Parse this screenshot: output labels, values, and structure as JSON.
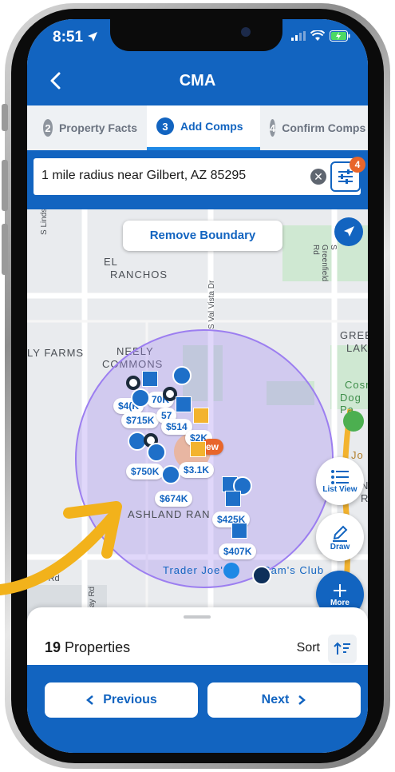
{
  "status": {
    "time": "8:51"
  },
  "header": {
    "title": "CMA"
  },
  "steps": [
    {
      "num": "2",
      "label": "Property Facts"
    },
    {
      "num": "3",
      "label": "Add Comps"
    },
    {
      "num": "4",
      "label": "Confirm Comps"
    }
  ],
  "search": {
    "query": "1 mile radius near Gilbert, AZ 85295",
    "filter_count": "4"
  },
  "map": {
    "remove_boundary_label": "Remove Boundary",
    "labels": {
      "el_ranchos_1": "EL",
      "el_ranchos_2": "RANCHOS",
      "neely_commons_1": "NEELY",
      "neely_commons_2": "COMMONS",
      "ly_farms": "LY FARMS",
      "greenfield_lakes_1": "GREENF",
      "greenfield_lakes_2": "LAKE",
      "ashland_ranch": "ASHLAND RAN",
      "trader_joes": "Trader Joe's",
      "sams_club": "Sam's Club",
      "cosmo_1": "Cosm",
      "cosmo_2": "Dog Pa",
      "s_lindsay": "S Lindsay R",
      "s_val_vista": "S Val Vista Dr",
      "s_greenfield": "S Greenfield Rd",
      "rd_left": "s Rd",
      "ay_rd": "ay Rd",
      "jo": "Jo",
      "ng_ro": "NG",
      "ro": "RO"
    },
    "prices": {
      "p1": "$4(",
      "p2": "70K",
      "p3": "$715K",
      "p4": "$514",
      "p5": "$2K",
      "p6": "$750K",
      "p7": "$3.1K",
      "p8": "$674K",
      "p9": "$425K",
      "p10": "$407K",
      "p11": "57",
      "p12": "$4(K"
    },
    "new_tag": "ew"
  },
  "fabs": {
    "list_view": "List View",
    "draw": "Draw",
    "more": "More"
  },
  "sheet": {
    "count": "19",
    "count_label": "Properties",
    "sort_label": "Sort"
  },
  "footer": {
    "previous": "Previous",
    "next": "Next"
  },
  "colors": {
    "primary": "#1264c0",
    "accent": "#e8662b",
    "radius": "#9c7ef0",
    "highlight": "#f3b32e"
  }
}
